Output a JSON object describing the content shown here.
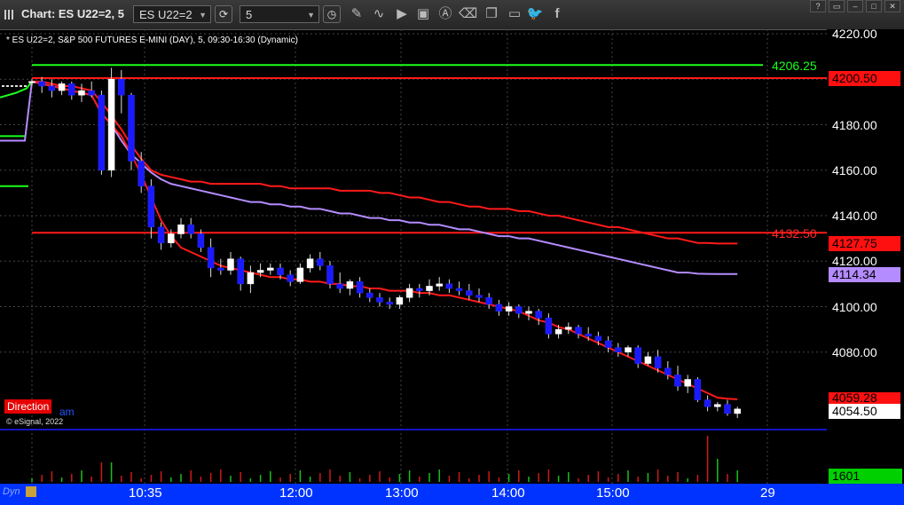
{
  "window": {
    "title": "Chart: ES U22=2, 5",
    "symbol_value": "ES U22=2",
    "interval_value": "5",
    "toolbar_icons": [
      "cycle-icon",
      "clock-icon",
      "pencil-icon",
      "squiggle-icon",
      "play-icon",
      "text-tool-icon",
      "letter-a-icon",
      "eraser-icon",
      "bookmark-icon",
      "comment-icon",
      "twitter-icon",
      "facebook-icon"
    ]
  },
  "chart_header": {
    "subtitle": "* ES U22=2, S&P 500 FUTURES E-MINI (DAY), 5, 09:30-16:30 (Dynamic)",
    "direction_label": "Direction",
    "direction_suffix": "am",
    "copyright": "© eSignal, 2022"
  },
  "colors": {
    "up_candle": "#ffffff",
    "down_candle": "#1a1aff",
    "resistance_line": "#ff1a1a",
    "support_line": "#1aff1a",
    "vwap": "#b48cff",
    "xaxis_bg": "#0033ff"
  },
  "levels": {
    "green_level": "4206.25",
    "red_level_top": "4200.50",
    "red_level_mid": "4132.50"
  },
  "price_tags": {
    "upper_band": "4127.75",
    "vwap": "4114.34",
    "lower_band": "4059.28",
    "last": "4054.50",
    "volume": "1601"
  },
  "chart_data": {
    "type": "candlestick",
    "symbol": "ES U22=2",
    "y_ticks": [
      "4220.00",
      "4200.00",
      "4180.00",
      "4160.00",
      "4140.00",
      "4120.00",
      "4100.00",
      "4080.00"
    ],
    "ylim": [
      4043,
      4224
    ],
    "x_ticks": [
      "10:35",
      "12:00",
      "13:00",
      "14:00",
      "15:00",
      "29"
    ],
    "horizontal_levels": [
      4206.25,
      4200.5,
      4132.5
    ],
    "candles": [
      [
        4199,
        4200,
        4197,
        4199
      ],
      [
        4199,
        4201,
        4194,
        4197
      ],
      [
        4197,
        4200,
        4192,
        4195
      ],
      [
        4195,
        4199,
        4193,
        4198
      ],
      [
        4198,
        4199,
        4191,
        4193
      ],
      [
        4193,
        4198,
        4190,
        4195
      ],
      [
        4195,
        4199,
        4192,
        4193
      ],
      [
        4193,
        4195,
        4158,
        4160
      ],
      [
        4160,
        4205,
        4157,
        4200
      ],
      [
        4200,
        4204,
        4185,
        4193
      ],
      [
        4193,
        4194,
        4160,
        4164
      ],
      [
        4164,
        4168,
        4150,
        4153
      ],
      [
        4153,
        4156,
        4130,
        4135
      ],
      [
        4135,
        4137,
        4125,
        4128
      ],
      [
        4128,
        4134,
        4126,
        4132
      ],
      [
        4132,
        4139,
        4130,
        4136
      ],
      [
        4136,
        4139,
        4130,
        4132
      ],
      [
        4132,
        4134,
        4124,
        4126
      ],
      [
        4126,
        4130,
        4113,
        4117
      ],
      [
        4117,
        4121,
        4114,
        4116
      ],
      [
        4116,
        4124,
        4114,
        4121
      ],
      [
        4121,
        4122,
        4107,
        4110
      ],
      [
        4110,
        4118,
        4106,
        4115
      ],
      [
        4115,
        4119,
        4113,
        4116
      ],
      [
        4116,
        4119,
        4114,
        4117
      ],
      [
        4117,
        4119,
        4112,
        4114
      ],
      [
        4114,
        4116,
        4109,
        4111
      ],
      [
        4111,
        4119,
        4110,
        4117
      ],
      [
        4117,
        4123,
        4115,
        4121
      ],
      [
        4121,
        4124,
        4116,
        4118
      ],
      [
        4118,
        4120,
        4108,
        4110
      ],
      [
        4110,
        4115,
        4106,
        4108
      ],
      [
        4108,
        4112,
        4105,
        4111
      ],
      [
        4111,
        4113,
        4104,
        4106
      ],
      [
        4106,
        4108,
        4102,
        4104
      ],
      [
        4104,
        4106,
        4100,
        4102
      ],
      [
        4102,
        4104,
        4099,
        4101
      ],
      [
        4101,
        4105,
        4099,
        4104
      ],
      [
        4104,
        4110,
        4102,
        4108
      ],
      [
        4108,
        4110,
        4104,
        4107
      ],
      [
        4107,
        4112,
        4105,
        4109
      ],
      [
        4109,
        4113,
        4107,
        4110
      ],
      [
        4110,
        4112,
        4106,
        4108
      ],
      [
        4108,
        4111,
        4105,
        4107
      ],
      [
        4107,
        4110,
        4103,
        4105
      ],
      [
        4105,
        4108,
        4102,
        4104
      ],
      [
        4104,
        4106,
        4099,
        4101
      ],
      [
        4101,
        4103,
        4096,
        4098
      ],
      [
        4098,
        4102,
        4096,
        4100
      ],
      [
        4100,
        4101,
        4095,
        4097
      ],
      [
        4097,
        4100,
        4094,
        4098
      ],
      [
        4098,
        4099,
        4092,
        4095
      ],
      [
        4095,
        4097,
        4086,
        4088
      ],
      [
        4088,
        4092,
        4086,
        4090
      ],
      [
        4090,
        4093,
        4088,
        4091
      ],
      [
        4091,
        4092,
        4086,
        4088
      ],
      [
        4088,
        4091,
        4085,
        4087
      ],
      [
        4087,
        4089,
        4083,
        4085
      ],
      [
        4085,
        4087,
        4080,
        4082
      ],
      [
        4082,
        4084,
        4078,
        4080
      ],
      [
        4080,
        4083,
        4078,
        4082
      ],
      [
        4082,
        4083,
        4073,
        4075
      ],
      [
        4075,
        4080,
        4074,
        4078
      ],
      [
        4078,
        4081,
        4071,
        4073
      ],
      [
        4073,
        4076,
        4068,
        4070
      ],
      [
        4070,
        4074,
        4063,
        4065
      ],
      [
        4065,
        4070,
        4062,
        4068
      ],
      [
        4068,
        4069,
        4058,
        4059
      ],
      [
        4059,
        4061,
        4054,
        4056
      ],
      [
        4056,
        4058,
        4054,
        4057
      ],
      [
        4057,
        4059,
        4052,
        4053
      ],
      [
        4053,
        4056,
        4051,
        4055
      ]
    ],
    "upper_band": [
      4199,
      4199,
      4198,
      4197,
      4197,
      4196,
      4195,
      4190,
      4184,
      4178,
      4171,
      4165,
      4160,
      4158,
      4157,
      4156,
      4155,
      4155,
      4154,
      4154,
      4154,
      4154,
      4154,
      4154,
      4153,
      4153,
      4152,
      4152,
      4152,
      4152,
      4152,
      4151,
      4151,
      4151,
      4151,
      4150,
      4150,
      4149,
      4148,
      4148,
      4147,
      4146,
      4146,
      4145,
      4144,
      4144,
      4143,
      4143,
      4143,
      4142,
      4142,
      4141,
      4140,
      4140,
      4139,
      4138,
      4137,
      4136,
      4135,
      4135,
      4134,
      4133,
      4132,
      4131,
      4130,
      4130,
      4129,
      4128,
      4128,
      4127.75,
      4127.75,
      4127.75
    ],
    "vwap": [
      4199,
      4198,
      4197,
      4196,
      4195,
      4194,
      4193,
      4185,
      4180,
      4173,
      4167,
      4163,
      4159,
      4156,
      4154,
      4153,
      4152,
      4151,
      4150,
      4149,
      4148,
      4147,
      4146,
      4146,
      4145,
      4145,
      4144,
      4144,
      4143,
      4143,
      4142,
      4141,
      4141,
      4140,
      4139,
      4139,
      4138,
      4138,
      4137,
      4137,
      4136,
      4136,
      4135,
      4134,
      4134,
      4133,
      4132,
      4131,
      4131,
      4130,
      4130,
      4129,
      4128,
      4127,
      4126,
      4125,
      4124,
      4123,
      4122,
      4121,
      4120,
      4119,
      4118,
      4117,
      4116,
      4115,
      4115,
      4114.5,
      4114.4,
      4114.34,
      4114.34,
      4114.34
    ],
    "lower_band": [
      4199,
      4198,
      4197,
      4196,
      4195,
      4194,
      4193,
      4185,
      4180,
      4175,
      4167,
      4158,
      4148,
      4138,
      4131,
      4126,
      4124,
      4122,
      4120,
      4118,
      4117,
      4116,
      4115,
      4114,
      4113,
      4113,
      4112,
      4112,
      4111,
      4111,
      4110,
      4110,
      4109,
      4109,
      4108,
      4108,
      4107,
      4107,
      4107,
      4106,
      4106,
      4105,
      4105,
      4104,
      4103,
      4102,
      4101,
      4100,
      4099,
      4098,
      4096,
      4094,
      4093,
      4091,
      4090,
      4088,
      4086,
      4084,
      4082,
      4080,
      4078,
      4076,
      4074,
      4072,
      4070,
      4068,
      4066,
      4064,
      4062,
      4060,
      4059.5,
      4059.28
    ]
  }
}
